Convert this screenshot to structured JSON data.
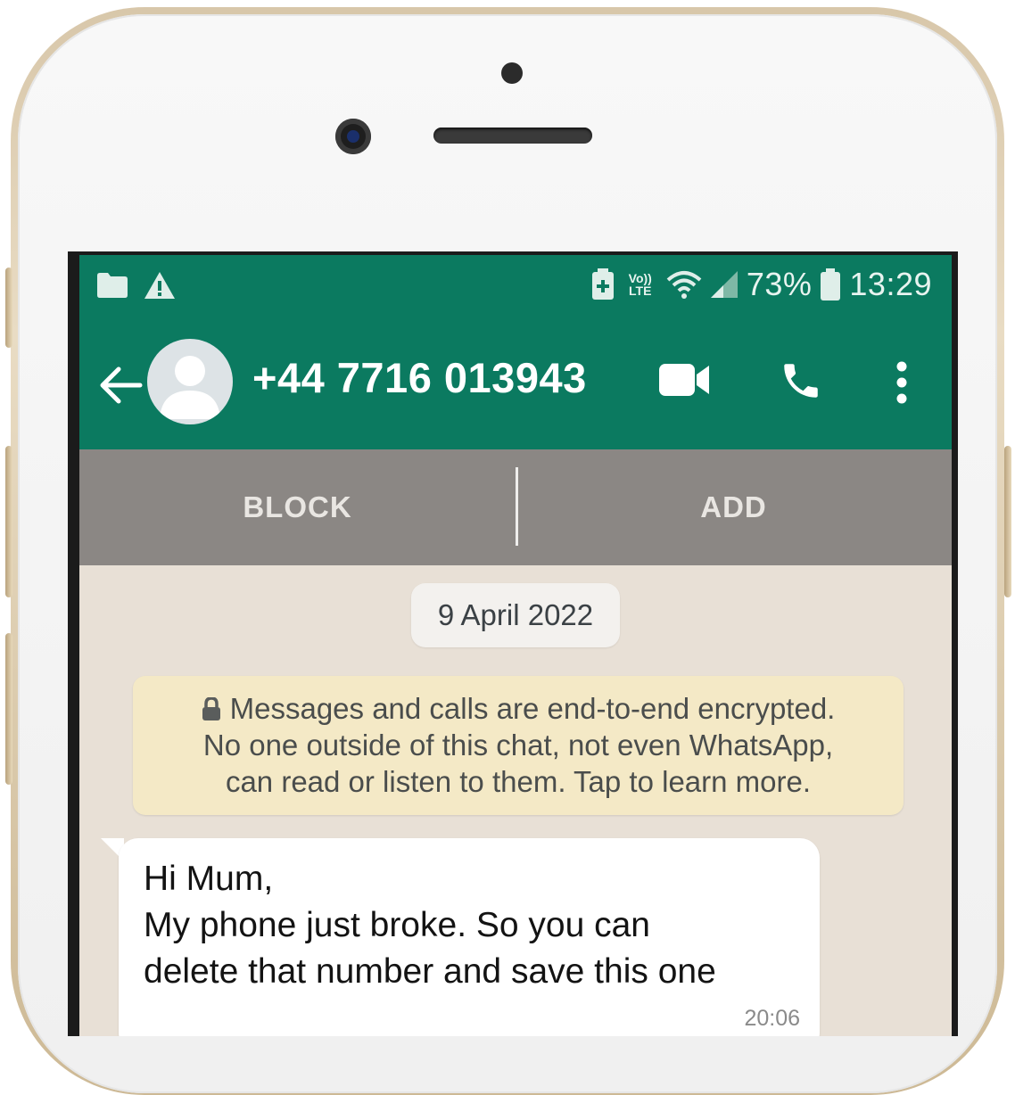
{
  "status_bar": {
    "signal_icons": [
      "folder-icon",
      "warning-icon",
      "battery-saver-icon",
      "volte-icon",
      "wifi-icon",
      "cell-signal-icon",
      "battery-icon"
    ],
    "volte_line1": "Vo))",
    "volte_line2": "LTE",
    "battery_percent": "73%",
    "time": "13:29"
  },
  "header": {
    "contact": "+44 7716 013943",
    "icons": [
      "back-arrow-icon",
      "avatar",
      "video-call-icon",
      "voice-call-icon",
      "more-options-icon"
    ]
  },
  "actions": {
    "block_label": "BLOCK",
    "add_label": "ADD"
  },
  "chat": {
    "date_chip": "9 April 2022",
    "encryption_notice": {
      "line1": "Messages and calls are end-to-end encrypted.",
      "line2": "No one outside of this chat, not even WhatsApp,",
      "line3": "can read or listen to them. Tap to learn more."
    },
    "messages": [
      {
        "lines": [
          "Hi Mum,",
          "My phone just broke. So you can",
          "delete that number and save this one"
        ],
        "time": "20:06"
      }
    ]
  },
  "colors": {
    "header_green": "#0b7a60",
    "action_bar_gray": "#8b8784",
    "chat_background": "#e8e0d6",
    "encryption_notice_bg": "#f4e9c6",
    "phone_frame_gold": "#d8c7aa"
  }
}
